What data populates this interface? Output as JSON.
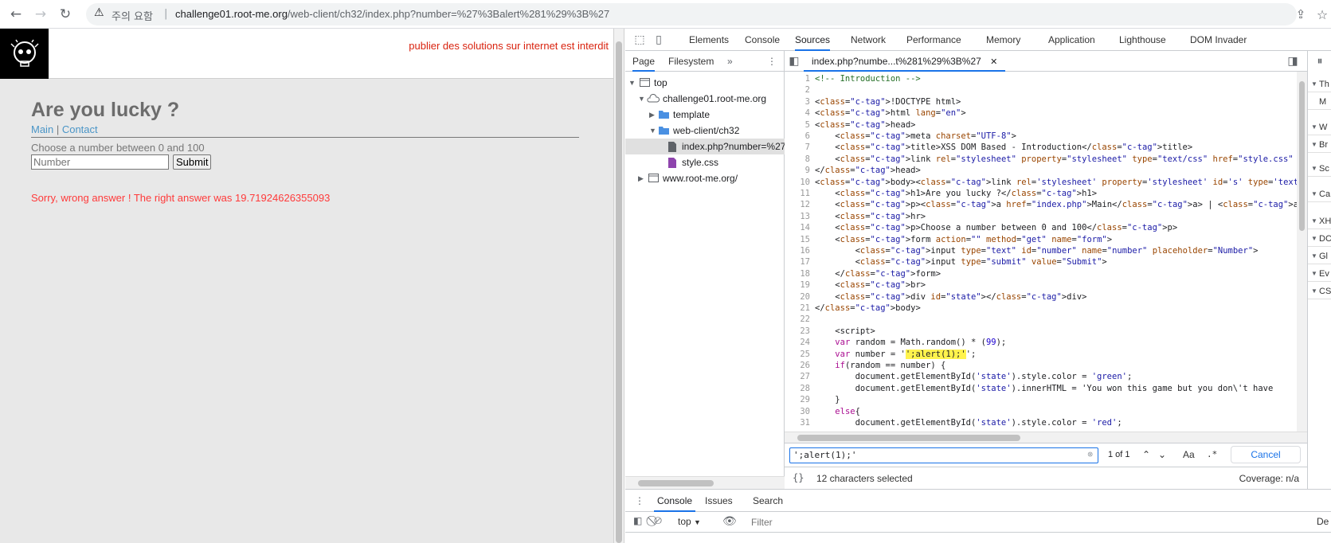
{
  "browser": {
    "security_warning": "주의 요함",
    "separator": "|",
    "url": "challenge01.root-me.org/web-client/ch32/index.php?number=%27%3Balert%281%29%3B%27",
    "url_host": "challenge01.root-me.org",
    "url_path": "/web-client/ch32/index.php?number=%27%3Balert%281%29%3B%27"
  },
  "page": {
    "warning": "publier des solutions sur internet est interdit",
    "title": "Are you lucky ?",
    "nav_main": "Main",
    "nav_sep": "|",
    "nav_contact": "Contact",
    "choose_text": "Choose a number between 0 and 100",
    "input_placeholder": "Number",
    "submit_label": "Submit",
    "result": "Sorry, wrong answer ! The right answer was 19.71924626355093",
    "result_color": "#ff3a3a"
  },
  "devtools": {
    "tabs": [
      "Elements",
      "Console",
      "Sources",
      "Network",
      "Performance",
      "Memory",
      "Application",
      "Lighthouse",
      "DOM Invader"
    ],
    "active_tab": "Sources",
    "navigator_tabs": [
      "Page",
      "Filesystem"
    ],
    "navigator_more": "»",
    "tree": [
      {
        "label": "top"
      },
      {
        "label": "challenge01.root-me.org"
      },
      {
        "label": "template"
      },
      {
        "label": "web-client/ch32"
      },
      {
        "label": "index.php?number=%27"
      },
      {
        "label": "style.css"
      },
      {
        "label": "www.root-me.org/"
      }
    ],
    "file_tab": "index.php?numbe...t%281%29%3B%27",
    "search": {
      "value": "';alert(1);'",
      "count": "1 of 1",
      "match_case": "Aa",
      "regex": ".*",
      "cancel": "Cancel"
    },
    "status": {
      "braces": "{}",
      "selected": "12 characters selected",
      "coverage": "Coverage: n/a"
    },
    "debug_rows": [
      "Th",
      "M",
      "W",
      "Br",
      "Sc",
      "Ca",
      "XH",
      "DC",
      "Gl",
      "Ev",
      "CS"
    ],
    "drawer_tabs": [
      "Console",
      "Issues",
      "Search"
    ],
    "console_context": "top",
    "filter_placeholder": "Filter",
    "filter_trailing": "De"
  },
  "code_lines": [
    "<!-- Introduction -->",
    "",
    "<!DOCTYPE html>",
    "<html lang=\"en\">",
    "<head>",
    "    <meta charset=\"UTF-8\">",
    "    <title>XSS DOM Based - Introduction</title>",
    "    <link rel=\"stylesheet\" property=\"stylesheet\" type=\"text/css\" href=\"style.css\" media=\"a",
    "</head>",
    "<body><link rel='stylesheet' property='stylesheet' id='s' type='text/css' href='/template/",
    "    <h1>Are you lucky ?</h1>",
    "    <p><a href=\"index.php\">Main</a> | <a href=\"contact.php\">Contact</a></p>",
    "    <hr>",
    "    <p>Choose a number between 0 and 100</p>",
    "    <form action=\"\" method=\"get\" name=\"form\">",
    "        <input type=\"text\" id=\"number\" name=\"number\" placeholder=\"Number\">",
    "        <input type=\"submit\" value=\"Submit\">",
    "    </form>",
    "    <br>",
    "    <div id=\"state\"></div>",
    "</body>",
    "",
    "    <script>",
    "    var random = Math.random() * (99);",
    "    var number = '';alert(1);'';",
    "    if(random == number) {",
    "        document.getElementById('state').style.color = 'green';",
    "        document.getElementById('state').innerHTML = 'You won this game but you don\\'t have",
    "    }",
    "    else{",
    "        document.getElementById('state').style.color = 'red';"
  ]
}
